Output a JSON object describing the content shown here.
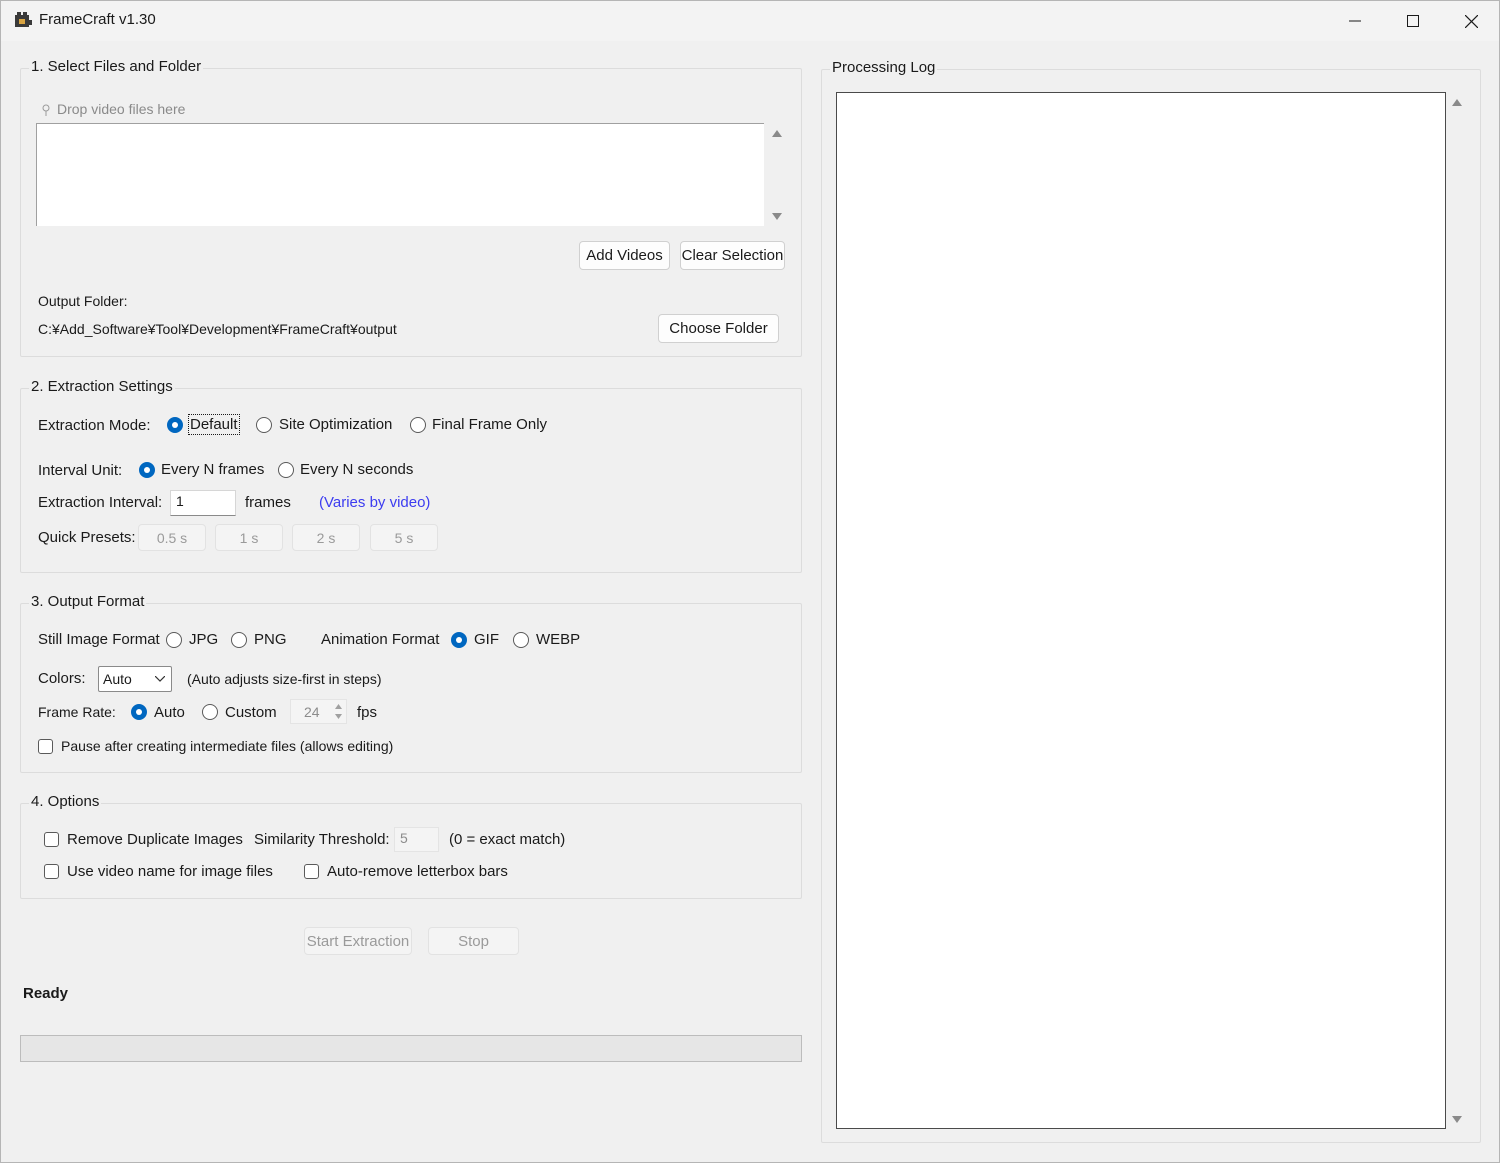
{
  "window": {
    "title": "FrameCraft v1.30",
    "controls": [
      "minimize-icon",
      "maximize-icon",
      "close-icon"
    ]
  },
  "section1": {
    "title": "1. Select Files and Folder",
    "drop_hint": "Drop video files here",
    "add_videos": "Add Videos",
    "clear_selection": "Clear Selection",
    "output_folder_label": "Output Folder:",
    "output_folder_path": "C:¥Add_Software¥Tool¥Development¥FrameCraft¥output",
    "choose_folder": "Choose Folder"
  },
  "section2": {
    "title": "2. Extraction Settings",
    "mode_label": "Extraction Mode:",
    "modes": [
      "Default",
      "Site Optimization",
      "Final Frame Only"
    ],
    "mode_selected": "Default",
    "interval_unit_label": "Interval Unit:",
    "interval_units": [
      "Every N frames",
      "Every N seconds"
    ],
    "interval_unit_selected": "Every N frames",
    "interval_label": "Extraction Interval:",
    "interval_value": "1",
    "interval_unit_text": "frames",
    "interval_note": "(Varies by video)",
    "presets_label": "Quick Presets:",
    "presets": [
      "0.5 s",
      "1 s",
      "2 s",
      "5 s"
    ]
  },
  "section3": {
    "title": "3. Output Format",
    "still_label": "Still Image Format",
    "still_options": [
      "JPG",
      "PNG"
    ],
    "anim_label": "Animation Format",
    "anim_options": [
      "GIF",
      "WEBP"
    ],
    "anim_selected": "GIF",
    "colors_label": "Colors:",
    "colors_value": "Auto",
    "colors_note": "(Auto adjusts size-first in steps)",
    "framerate_label": "Frame Rate:",
    "framerate_options": [
      "Auto",
      "Custom"
    ],
    "framerate_selected": "Auto",
    "fps_value": "24",
    "fps_unit": "fps",
    "pause_label": "Pause after creating intermediate files (allows editing)",
    "pause_checked": false
  },
  "section4": {
    "title": "4. Options",
    "remove_dupes": "Remove Duplicate Images",
    "similarity_label": "Similarity Threshold:",
    "similarity_value": "5",
    "similarity_note": "(0 = exact match)",
    "use_video_name": "Use video name for image files",
    "auto_remove_letterbox": "Auto-remove letterbox bars"
  },
  "actions": {
    "start": "Start Extraction",
    "stop": "Stop"
  },
  "status": {
    "text": "Ready",
    "progress": 0
  },
  "log": {
    "title": "Processing Log"
  }
}
